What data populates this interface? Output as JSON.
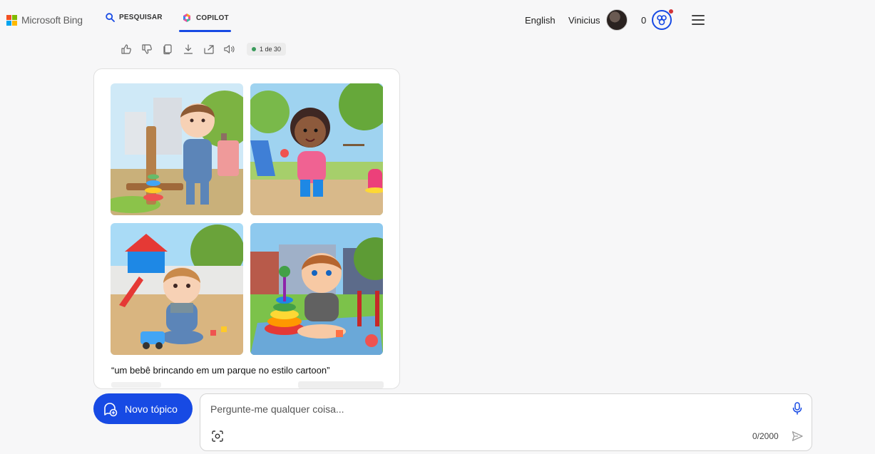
{
  "header": {
    "logo_text": "Microsoft Bing",
    "tabs": [
      {
        "label": "PESQUISAR",
        "icon": "search-icon"
      },
      {
        "label": "COPILOT",
        "icon": "copilot-icon",
        "active": true
      }
    ],
    "language": "English",
    "user_name": "Vinicius",
    "points": "0",
    "accent_color": "#174ae4"
  },
  "toolbar": {
    "icons": [
      "thumbs-up-icon",
      "thumbs-down-icon",
      "copy-icon",
      "download-icon",
      "share-icon",
      "speaker-icon"
    ],
    "counter": "1 de 30"
  },
  "result": {
    "caption": "“um bebê brincando em um parque no estilo cartoon”",
    "images": [
      {
        "name": "generated-image-1"
      },
      {
        "name": "generated-image-2"
      },
      {
        "name": "generated-image-3"
      },
      {
        "name": "generated-image-4"
      }
    ]
  },
  "composer": {
    "new_topic_label": "Novo tópico",
    "placeholder": "Pergunte-me qualquer coisa...",
    "char_count": "0/2000"
  }
}
